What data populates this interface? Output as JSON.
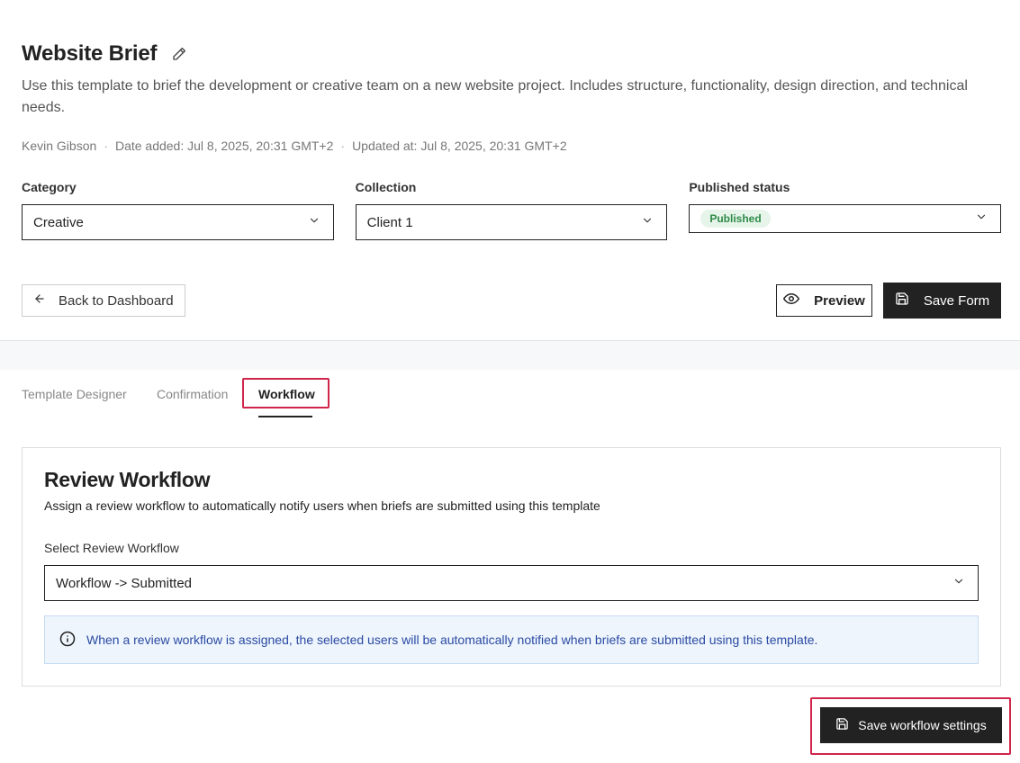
{
  "header": {
    "title": "Website Brief",
    "description": "Use this template to brief the development or creative team on a new website project. Includes structure, functionality, design direction, and technical needs.",
    "author": "Kevin Gibson",
    "date_added": "Date added: Jul 8, 2025, 20:31 GMT+2",
    "updated_at": "Updated at: Jul 8, 2025, 20:31 GMT+2",
    "separator": "·"
  },
  "fields": {
    "category": {
      "label": "Category",
      "value": "Creative"
    },
    "collection": {
      "label": "Collection",
      "value": "Client 1"
    },
    "published_status": {
      "label": "Published status",
      "value": "Published"
    }
  },
  "actions": {
    "back_label": "Back to Dashboard",
    "preview_label": "Preview",
    "save_form_label": "Save Form"
  },
  "tabs": [
    {
      "label": "Template Designer"
    },
    {
      "label": "Confirmation"
    },
    {
      "label": "Workflow",
      "active": true
    }
  ],
  "workflow_panel": {
    "title": "Review Workflow",
    "description": "Assign a review workflow to automatically notify users when briefs are submitted using this template",
    "select_label": "Select Review Workflow",
    "select_value": "Workflow -> Submitted",
    "info_text": "When a review workflow is assigned, the selected users will be automatically notified when briefs are submitted using this template."
  },
  "save_workflow_label": "Save workflow settings",
  "colors": {
    "highlight": "#d0254a",
    "primary_button": "#222222",
    "badge_bg": "#e6f4ea",
    "badge_text": "#2e8b47",
    "info_bg": "#eef5fd",
    "info_text": "#2a4aa3"
  },
  "icons": {
    "edit": "pencil-icon",
    "chevron": "chevron-down-icon",
    "back": "arrow-left-icon",
    "preview": "eye-icon",
    "save": "floppy-disk-icon",
    "info": "info-circle-icon"
  }
}
